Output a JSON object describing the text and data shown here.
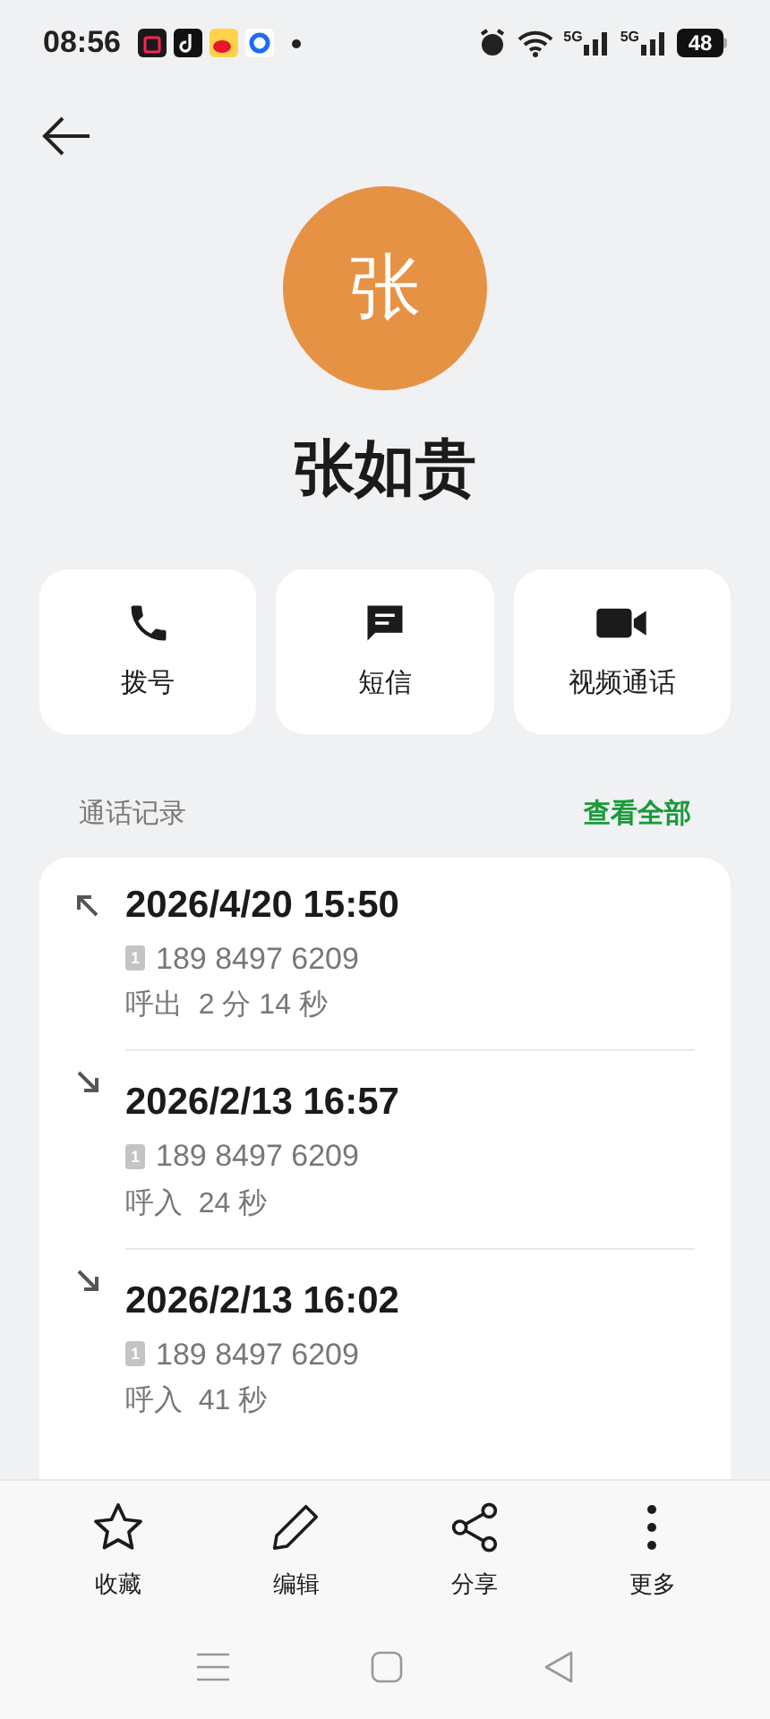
{
  "status_bar": {
    "time": "08:56",
    "signal_labels": [
      "5G",
      "5G"
    ],
    "battery": "48"
  },
  "contact": {
    "avatar_letter": "张",
    "name": "张如贵"
  },
  "actions": [
    {
      "kind": "call",
      "label": "拨号"
    },
    {
      "kind": "message",
      "label": "短信"
    },
    {
      "kind": "video",
      "label": "视频通话"
    }
  ],
  "call_log": {
    "title": "通话记录",
    "view_all": "查看全部",
    "entries": [
      {
        "kind": "outgoing",
        "time": "2026/4/20 15:50",
        "sim": "1",
        "number": "189 8497 6209",
        "detail": "呼出  2 分 14 秒"
      },
      {
        "kind": "incoming",
        "time": "2026/2/13 16:57",
        "sim": "1",
        "number": "189 8497 6209",
        "detail": "呼入  24 秒"
      },
      {
        "kind": "incoming",
        "time": "2026/2/13 16:02",
        "sim": "1",
        "number": "189 8497 6209",
        "detail": "呼入  41 秒"
      }
    ]
  },
  "bottom_bar": [
    {
      "kind": "star",
      "label": "收藏"
    },
    {
      "kind": "edit",
      "label": "编辑"
    },
    {
      "kind": "share",
      "label": "分享"
    },
    {
      "kind": "more",
      "label": "更多"
    }
  ]
}
